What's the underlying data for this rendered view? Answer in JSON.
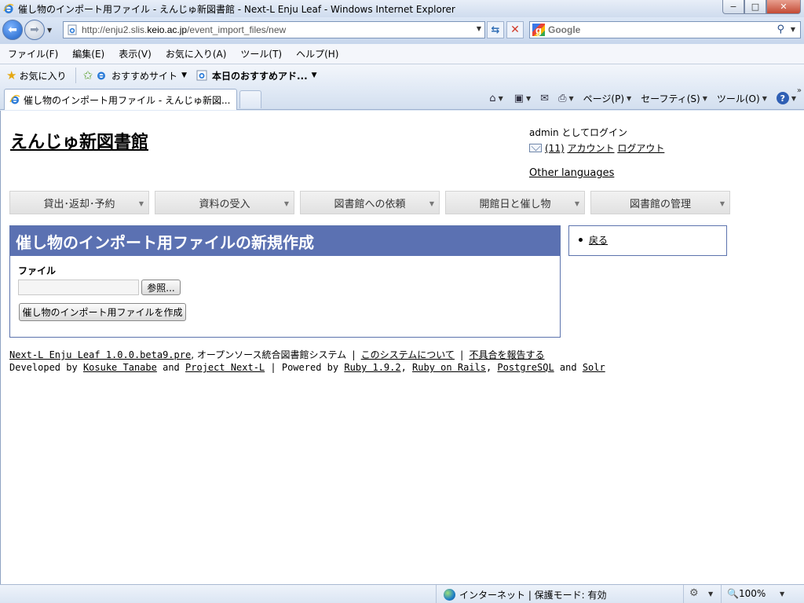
{
  "window": {
    "title": "催し物のインポート用ファイル - えんじゅ新図書館 - Next-L Enju Leaf - Windows Internet Explorer",
    "min_label": "−",
    "max_label": "□",
    "close_label": "✕"
  },
  "address": {
    "url_prefix": "http://enju2.slis.",
    "url_domain": "keio.ac.jp",
    "url_suffix": "/event_import_files/new"
  },
  "search": {
    "placeholder": "Google"
  },
  "menu": {
    "items": [
      "ファイル(F)",
      "編集(E)",
      "表示(V)",
      "お気に入り(A)",
      "ツール(T)",
      "ヘルプ(H)"
    ]
  },
  "favorites": {
    "favorites_label": "お気に入り",
    "suggested_sites": "おすすめサイト",
    "web_slice": "本日のおすすめアド..."
  },
  "tabs": {
    "active_label": "催し物のインポート用ファイル - えんじゅ新図...",
    "page_menu": "ページ(P)",
    "safety_menu": "セーフティ(S)",
    "tools_menu": "ツール(O)",
    "help_icon": "?"
  },
  "site": {
    "title": "えんじゅ新図書館",
    "user_login": "admin としてログイン",
    "message_count": "(11)",
    "account_link": "アカウント",
    "logout_link": "ログアウト",
    "other_languages": "Other languages"
  },
  "nav": {
    "items": [
      "貸出･返却･予約",
      "資料の受入",
      "図書館への依頼",
      "開館日と催し物",
      "図書館の管理"
    ]
  },
  "main": {
    "heading": "催し物のインポート用ファイルの新規作成",
    "file_label": "ファイル",
    "browse_button": "参照...",
    "submit_button": "催し物のインポート用ファイルを作成"
  },
  "side": {
    "back_link": "戻る"
  },
  "footer": {
    "product_link": "Next-L Enju Leaf 1.0.0.beta9.pre",
    "product_desc": ", オープンソース統合図書館システム",
    "about_link": "このシステムについて",
    "report_link": "不具合を報告する",
    "developed_by": "Developed by",
    "developer_link": "Kosuke Tanabe",
    "and1": "and",
    "project_link": "Project Next-L",
    "powered_by": "| Powered by",
    "ruby_link": "Ruby 1.9.2",
    "rails_link": "Ruby on Rails",
    "pg_link": "PostgreSQL",
    "and2": "and",
    "solr_link": "Solr"
  },
  "status": {
    "zone": "インターネット | 保護モード: 有効",
    "zoom": "100%"
  }
}
